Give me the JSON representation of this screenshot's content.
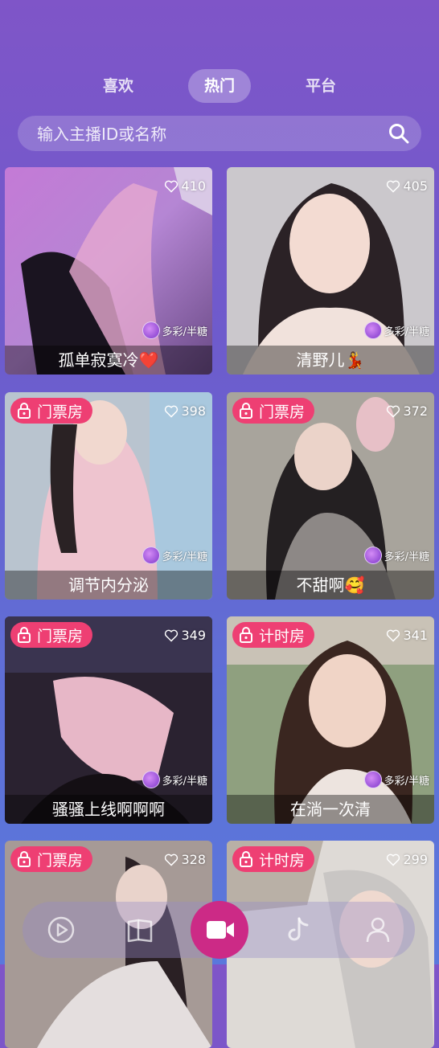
{
  "tabs": [
    {
      "label": "喜欢"
    },
    {
      "label": "热门"
    },
    {
      "label": "平台"
    }
  ],
  "search": {
    "placeholder": "输入主播ID或名称"
  },
  "cards": [
    {
      "name": "孤单寂寞冷❤️",
      "likes": "410",
      "badge": "",
      "platform": "多彩/半糖"
    },
    {
      "name": "清野儿💃",
      "likes": "405",
      "badge": "",
      "platform": "多彩/半糖"
    },
    {
      "name": "调节内分泌",
      "likes": "398",
      "badge": "门票房",
      "platform": "多彩/半糖"
    },
    {
      "name": "不甜啊🥰",
      "likes": "372",
      "badge": "门票房",
      "platform": "多彩/半糖"
    },
    {
      "name": "骚骚上线啊啊啊",
      "likes": "349",
      "badge": "门票房",
      "platform": "多彩/半糖"
    },
    {
      "name": "在淌一次清",
      "likes": "341",
      "badge": "计时房",
      "platform": "多彩/半糖"
    },
    {
      "name": "",
      "likes": "328",
      "badge": "门票房",
      "platform": ""
    },
    {
      "name": "",
      "likes": "299",
      "badge": "计时房",
      "platform": ""
    }
  ],
  "nav": {
    "items": [
      "play-icon",
      "book-icon",
      "video-camera-icon",
      "tiktok-icon",
      "profile-icon"
    ],
    "accent": "#cc2a86"
  },
  "colors": {
    "badge": "#ee3f73",
    "background_top": "#7f55c8",
    "background_bottom": "#5a78dc"
  }
}
